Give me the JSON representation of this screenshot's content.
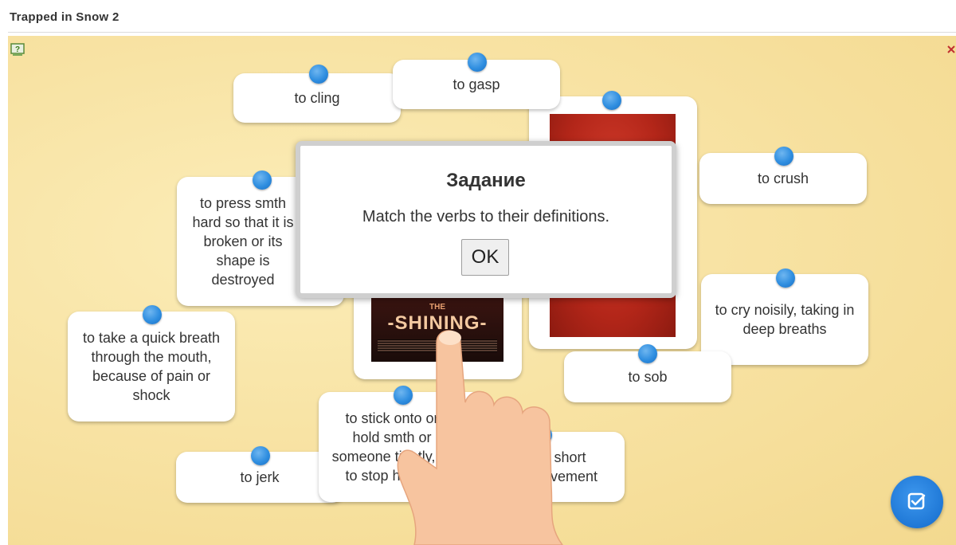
{
  "app": {
    "title": "Trapped in Snow 2"
  },
  "cards": {
    "to_cling": "to cling",
    "to_gasp": "to gasp",
    "to_crush": "to crush",
    "press_def": "to press smth hard so that it is broken or its shape is destroyed",
    "quick_breath_def": "to take a quick breath through the mouth, because of pain or shock",
    "cry_def": "to cry noisily, taking in deep breaths",
    "to_sob": "to sob",
    "to_jerk": "to jerk",
    "stick_def": "to stick onto or hold smth or someone tightly, or to stop holding",
    "short_movement_def": "a short movement"
  },
  "poster": {
    "tagline": "THE",
    "title": "-SHINING-"
  },
  "dialog": {
    "title": "Задание",
    "message": "Match the verbs to their definitions.",
    "ok_label": "OK"
  },
  "icons": {
    "help": "help-icon",
    "check": "check-icon",
    "hand": "pointing-hand-icon"
  },
  "colors": {
    "accent": "#1f78d6",
    "board": "#f8e3a4",
    "card": "#ffffff"
  }
}
